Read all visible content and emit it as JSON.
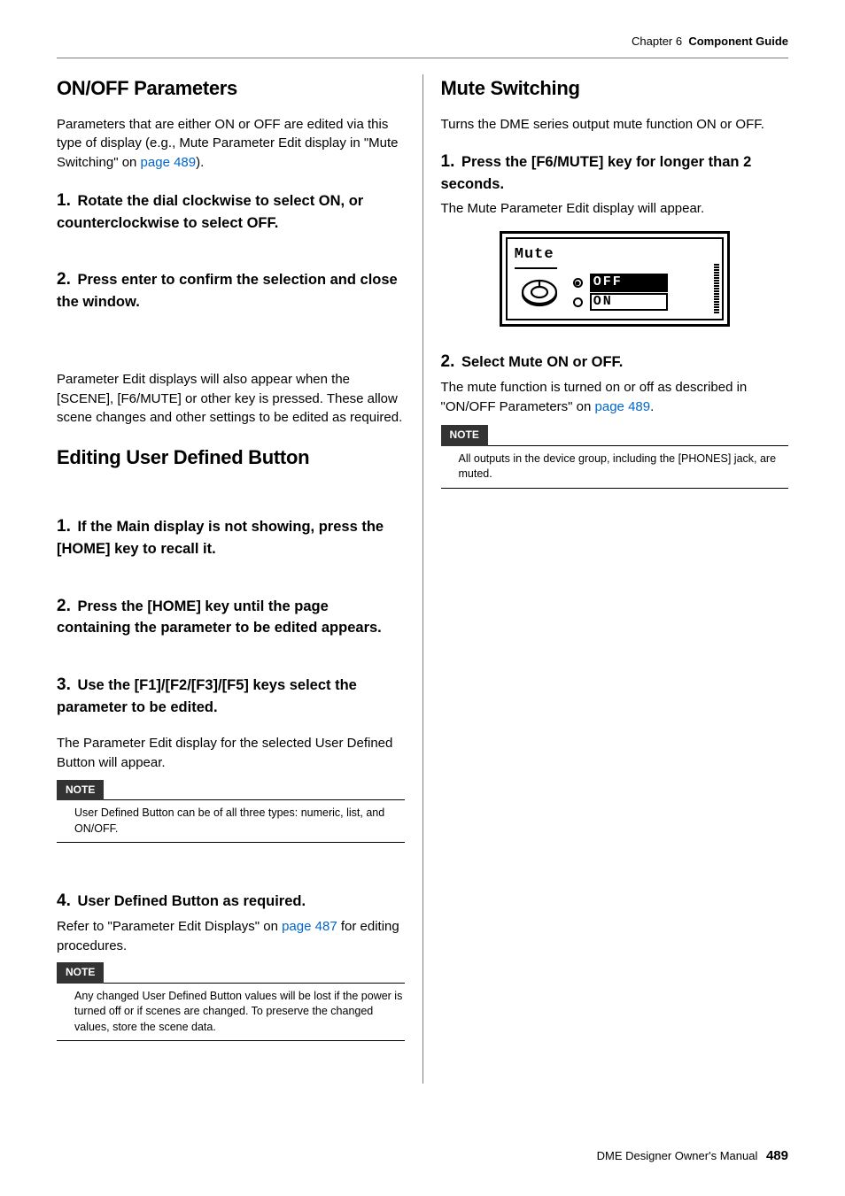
{
  "header": {
    "chapter": "Chapter 6",
    "title": "Component Guide"
  },
  "left": {
    "s1": {
      "heading": "ON/OFF Parameters",
      "intro_a": "Parameters that are either ON or OFF are edited via this type of display (e.g., Mute Parameter Edit display in \"Mute Switching\" on ",
      "intro_link": "page 489",
      "intro_b": ").",
      "step1_n": "1.",
      "step1": " Rotate the dial clockwise to select ON, or counterclockwise to select OFF.",
      "step2_n": "2.",
      "step2": " Press enter to confirm the selection and close the window.",
      "para2": "Parameter Edit displays will also appear when the [SCENE], [F6/MUTE] or other key is pressed. These allow scene changes and other settings to be edited as required."
    },
    "s2": {
      "heading": "Editing User Defined Button",
      "step1_n": "1.",
      "step1": " If the Main display is not showing, press the [HOME] key to recall it.",
      "step2_n": "2.",
      "step2": " Press the [HOME] key until the page containing the parameter to be edited appears.",
      "step3_n": "3.",
      "step3": " Use the [F1]/[F2/[F3]/[F5] keys select the parameter to be edited.",
      "after3": "The Parameter Edit display for the selected User Defined Button will appear.",
      "note1_label": "NOTE",
      "note1": "User Defined Button can be of all three types: numeric, list, and ON/OFF.",
      "step4_n": "4.",
      "step4": " User Defined Button as required.",
      "after4_a": "Refer to \"Parameter Edit Displays\" on ",
      "after4_link": "page 487",
      "after4_b": " for editing procedures.",
      "note2_label": "NOTE",
      "note2": "Any changed User Defined Button values will be lost if the power is turned off or if scenes are changed. To preserve the changed values, store the scene data."
    }
  },
  "right": {
    "heading": "Mute Switching",
    "intro": "Turns the DME series output mute function ON or OFF.",
    "step1_n": "1.",
    "step1": " Press the [F6/MUTE] key for longer than 2 seconds.",
    "after1": "The Mute Parameter Edit display will appear.",
    "lcd": {
      "title": "Mute",
      "off": "OFF",
      "on": "ON"
    },
    "step2_n": "2.",
    "step2": " Select Mute ON or OFF.",
    "after2_a": "The mute function is turned on or off as described in \"ON/OFF Parameters\" on ",
    "after2_link": "page 489",
    "after2_b": ".",
    "note_label": "NOTE",
    "note": "All outputs in the device group, including the [PHONES] jack, are muted."
  },
  "footer": {
    "text": "DME Designer Owner's Manual",
    "page": "489"
  }
}
